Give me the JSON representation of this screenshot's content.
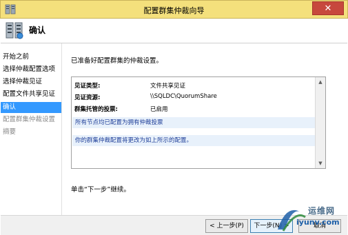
{
  "window": {
    "title": "配置群集仲裁向导",
    "close_label": "✕"
  },
  "header": {
    "title": "确认"
  },
  "sidebar": {
    "items": [
      {
        "label": "开始之前",
        "state": "normal"
      },
      {
        "label": "选择仲裁配置选项",
        "state": "normal"
      },
      {
        "label": "选择仲裁见证",
        "state": "normal"
      },
      {
        "label": "配置文件共享见证",
        "state": "normal"
      },
      {
        "label": "确认",
        "state": "active"
      },
      {
        "label": "配置群集仲裁设置",
        "state": "disabled"
      },
      {
        "label": "摘要",
        "state": "disabled"
      }
    ]
  },
  "main": {
    "intro": "已准备好配置群集的仲裁设置。",
    "report": {
      "rows": [
        {
          "key": "见证类型:",
          "value": "文件共享见证"
        },
        {
          "key": "见证资源:",
          "value": "\\\\SQLDC\\QuorumShare"
        },
        {
          "key": "群集托管的投票:",
          "value": "已启用"
        }
      ],
      "notes": [
        "所有节点均已配置为拥有仲裁投票",
        "你的群集仲裁配置将更改为如上所示的配置。"
      ]
    },
    "hint": "单击“下一步”继续。"
  },
  "footer": {
    "prev_label": "< 上一步(P)",
    "next_label": "下一步(N) >",
    "cancel_label": "取消"
  },
  "watermark": {
    "text": "运维网",
    "url": "iyunv.com"
  },
  "colors": {
    "titlebar": "#f4e07c",
    "active_nav": "#3399ff",
    "close_button": "#c7483d",
    "note_text": "#1f3f99"
  }
}
